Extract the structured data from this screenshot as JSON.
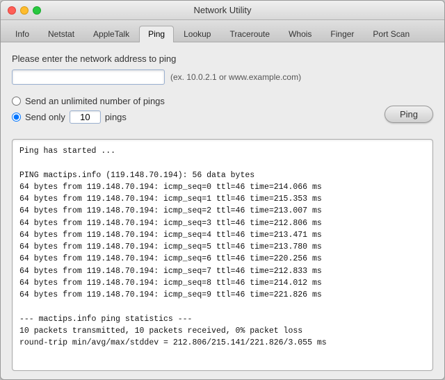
{
  "window": {
    "title": "Network Utility"
  },
  "tabs": [
    {
      "label": "Info",
      "active": false
    },
    {
      "label": "Netstat",
      "active": false
    },
    {
      "label": "AppleTalk",
      "active": false
    },
    {
      "label": "Ping",
      "active": true
    },
    {
      "label": "Lookup",
      "active": false
    },
    {
      "label": "Traceroute",
      "active": false
    },
    {
      "label": "Whois",
      "active": false
    },
    {
      "label": "Finger",
      "active": false
    },
    {
      "label": "Port Scan",
      "active": false
    }
  ],
  "main": {
    "address_label": "Please enter the network address to ping",
    "address_placeholder": "",
    "address_hint": "(ex. 10.0.2.1 or www.example.com)",
    "radio_unlimited": "Send an unlimited number of pings",
    "radio_only_prefix": "Send only",
    "radio_only_count": "10",
    "radio_only_suffix": "pings",
    "ping_button_label": "Ping",
    "output": "Ping has started ...\n\nPING mactips.info (119.148.70.194): 56 data bytes\n64 bytes from 119.148.70.194: icmp_seq=0 ttl=46 time=214.066 ms\n64 bytes from 119.148.70.194: icmp_seq=1 ttl=46 time=215.353 ms\n64 bytes from 119.148.70.194: icmp_seq=2 ttl=46 time=213.007 ms\n64 bytes from 119.148.70.194: icmp_seq=3 ttl=46 time=212.806 ms\n64 bytes from 119.148.70.194: icmp_seq=4 ttl=46 time=213.471 ms\n64 bytes from 119.148.70.194: icmp_seq=5 ttl=46 time=213.780 ms\n64 bytes from 119.148.70.194: icmp_seq=6 ttl=46 time=220.256 ms\n64 bytes from 119.148.70.194: icmp_seq=7 ttl=46 time=212.833 ms\n64 bytes from 119.148.70.194: icmp_seq=8 ttl=46 time=214.012 ms\n64 bytes from 119.148.70.194: icmp_seq=9 ttl=46 time=221.826 ms\n\n--- mactips.info ping statistics ---\n10 packets transmitted, 10 packets received, 0% packet loss\nround-trip min/avg/max/stddev = 212.806/215.141/221.826/3.055 ms"
  }
}
